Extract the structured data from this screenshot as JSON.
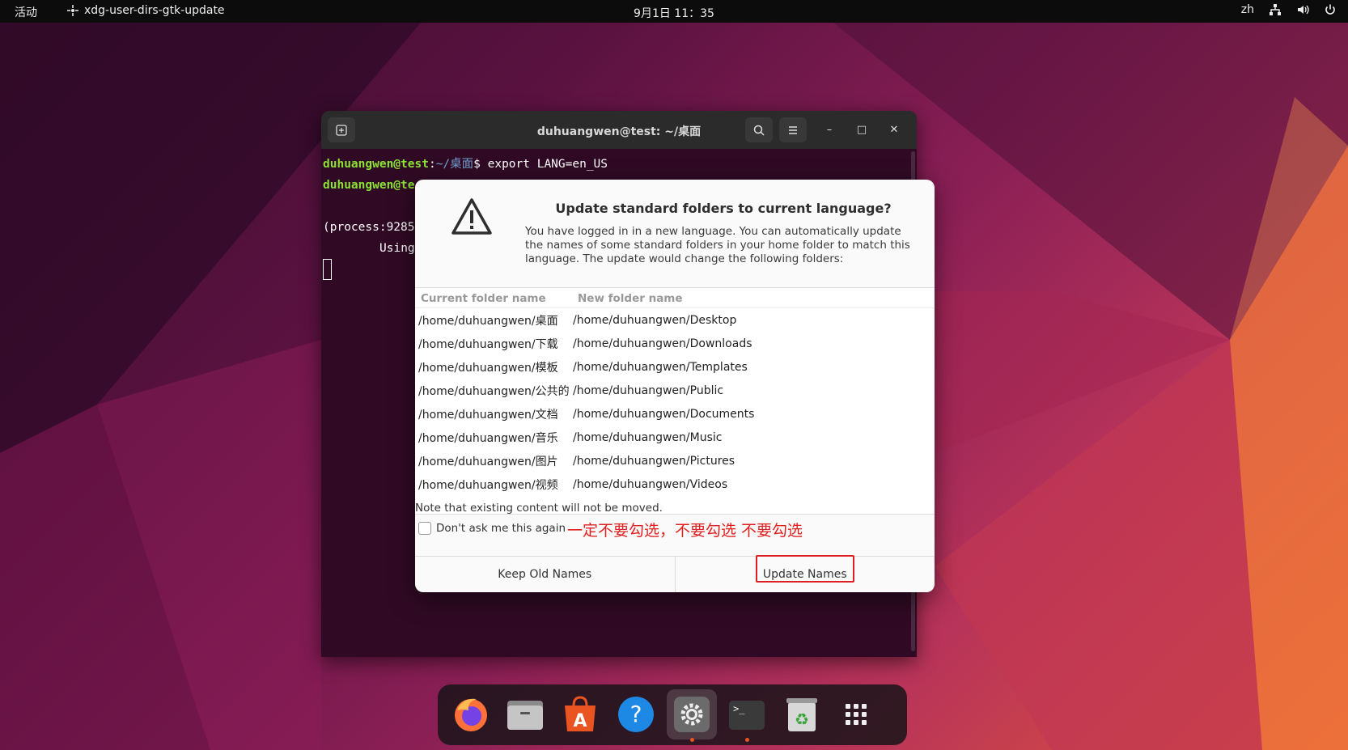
{
  "topbar": {
    "activities": "活动",
    "app_name": "xdg-user-dirs-gtk-update",
    "clock": "9月1日  11：35",
    "lang": "zh"
  },
  "terminal": {
    "title": "duhuangwen@test: ~/桌面",
    "lines": [
      {
        "user": "duhuangwen@test",
        "path": "~/桌面",
        "cmd": "$ export LANG=en_US"
      },
      {
        "user": "duhuangwen@te",
        "path": "",
        "cmd": ""
      }
    ],
    "process_line": "(process:9285",
    "using_line": "Using"
  },
  "dialog": {
    "title": "Update standard folders to current language?",
    "description": "You have logged in in a new language. You can automatically update the names of some standard folders in your home folder to match this language. The update would change the following folders:",
    "col_current": "Current folder name",
    "col_new": "New folder name",
    "rows": [
      {
        "current": "/home/duhuangwen/桌面",
        "new": "/home/duhuangwen/Desktop"
      },
      {
        "current": "/home/duhuangwen/下载",
        "new": "/home/duhuangwen/Downloads"
      },
      {
        "current": "/home/duhuangwen/模板",
        "new": "/home/duhuangwen/Templates"
      },
      {
        "current": "/home/duhuangwen/公共的",
        "new": "/home/duhuangwen/Public"
      },
      {
        "current": "/home/duhuangwen/文档",
        "new": "/home/duhuangwen/Documents"
      },
      {
        "current": "/home/duhuangwen/音乐",
        "new": "/home/duhuangwen/Music"
      },
      {
        "current": "/home/duhuangwen/图片",
        "new": "/home/duhuangwen/Pictures"
      },
      {
        "current": "/home/duhuangwen/视频",
        "new": "/home/duhuangwen/Videos"
      }
    ],
    "note": "Note that existing content will not be moved.",
    "checkbox_label": "Don't ask me this again",
    "checkbox_checked": false,
    "annotation": "一定不要勾选，不要勾选 不要勾选",
    "keep_button": "Keep Old Names",
    "update_button": "Update Names"
  },
  "dock": {
    "items": [
      "firefox-icon",
      "files-icon",
      "app-center-icon",
      "help-icon",
      "settings-icon",
      "terminal-icon",
      "trash-icon",
      "app-grid-icon"
    ]
  }
}
